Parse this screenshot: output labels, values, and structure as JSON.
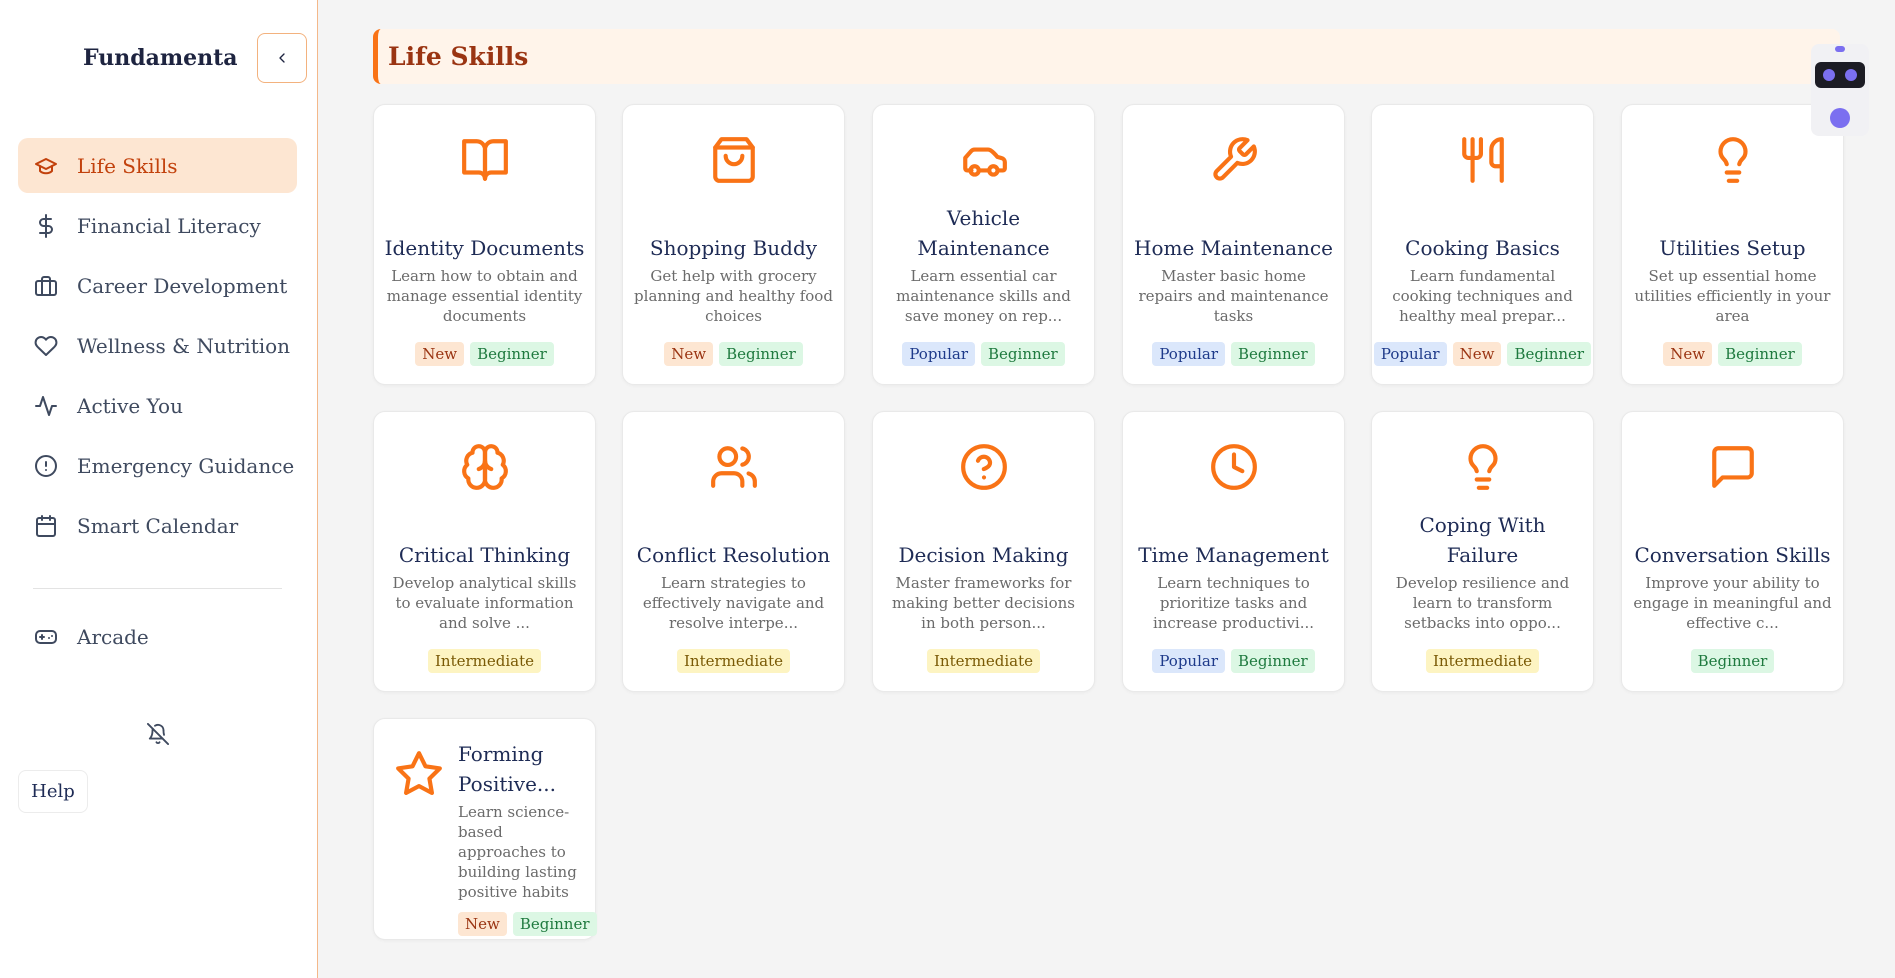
{
  "app": {
    "title": "Fundamenta"
  },
  "nav": {
    "items": [
      {
        "label": "Life Skills",
        "icon": "graduation-cap-icon",
        "active": true
      },
      {
        "label": "Financial Literacy",
        "icon": "dollar-icon"
      },
      {
        "label": "Career Development",
        "icon": "briefcase-icon"
      },
      {
        "label": "Wellness & Nutrition",
        "icon": "heart-icon"
      },
      {
        "label": "Active You",
        "icon": "activity-icon"
      },
      {
        "label": "Emergency Guidance",
        "icon": "alert-circle-icon"
      },
      {
        "label": "Smart Calendar",
        "icon": "calendar-icon"
      }
    ],
    "arcade": {
      "label": "Arcade",
      "icon": "gamepad-icon"
    },
    "help_label": "Help"
  },
  "page": {
    "title": "Life Skills"
  },
  "colors": {
    "accent": "#f97316",
    "accent_dark": "#c2410c"
  },
  "cards": [
    {
      "title": "Identity Documents",
      "description": "Learn how to obtain and manage essential identity documents",
      "icon": "book-open-icon",
      "tags": [
        "New",
        "Beginner"
      ]
    },
    {
      "title": "Shopping Buddy",
      "description": "Get help with grocery planning and healthy food choices",
      "icon": "shopping-bag-icon",
      "tags": [
        "New",
        "Beginner"
      ]
    },
    {
      "title": "Vehicle Maintenance",
      "description": "Learn essential car maintenance skills and save money on rep...",
      "icon": "car-icon",
      "tags": [
        "Popular",
        "Beginner"
      ]
    },
    {
      "title": "Home Maintenance",
      "description": "Master basic home repairs and maintenance tasks",
      "icon": "wrench-icon",
      "tags": [
        "Popular",
        "Beginner"
      ]
    },
    {
      "title": "Cooking Basics",
      "description": "Learn fundamental cooking techniques and healthy meal prepar...",
      "icon": "utensils-icon",
      "tags": [
        "Popular",
        "New",
        "Beginner"
      ]
    },
    {
      "title": "Utilities Setup",
      "description": "Set up essential home utilities efficiently in your area",
      "icon": "lightbulb-icon",
      "tags": [
        "New",
        "Beginner"
      ]
    },
    {
      "title": "Critical Thinking",
      "description": "Develop analytical skills to evaluate information and solve ...",
      "icon": "brain-icon",
      "tags": [
        "Intermediate"
      ]
    },
    {
      "title": "Conflict Resolution",
      "description": "Learn strategies to effectively navigate and resolve interpe...",
      "icon": "users-icon",
      "tags": [
        "Intermediate"
      ]
    },
    {
      "title": "Decision Making",
      "description": "Master frameworks for making better decisions in both person...",
      "icon": "help-circle-icon",
      "tags": [
        "Intermediate"
      ]
    },
    {
      "title": "Time Management",
      "description": "Learn techniques to prioritize tasks and increase productivi...",
      "icon": "clock-icon",
      "tags": [
        "Popular",
        "Beginner"
      ]
    },
    {
      "title": "Coping With Failure",
      "description": "Develop resilience and learn to transform setbacks into oppo...",
      "icon": "lightbulb-icon",
      "tags": [
        "Intermediate"
      ]
    },
    {
      "title": "Conversation Skills",
      "description": "Improve your ability to engage in meaningful and effective c...",
      "icon": "message-square-icon",
      "tags": [
        "Beginner"
      ]
    }
  ],
  "featured_card": {
    "title": "Forming Positive...",
    "description": "Learn science-based approaches to building lasting positive habits",
    "icon": "star-icon",
    "tags": [
      "New",
      "Beginner"
    ]
  }
}
